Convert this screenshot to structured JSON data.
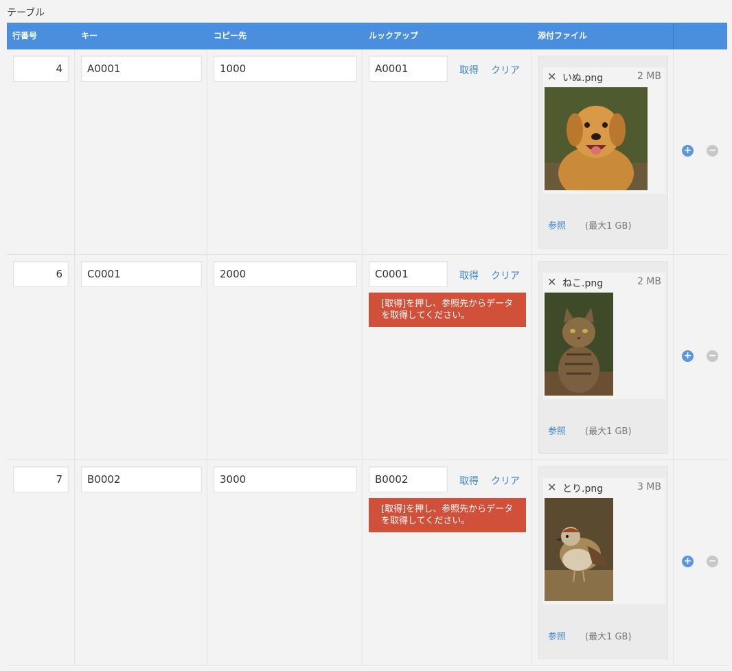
{
  "table_label": "テーブル",
  "headers": {
    "row_no": "行番号",
    "key": "キー",
    "copy_to": "コピー先",
    "lookup": "ルックアップ",
    "attachment": "添付ファイル"
  },
  "rows": [
    {
      "row_no": "4",
      "key": "A0001",
      "copy_to": "1000",
      "lookup": "A0001",
      "fetch": "取得",
      "clear": "クリア",
      "error": "",
      "file": {
        "name": "いぬ.png",
        "size": "2 MB",
        "icon": "dog-photo"
      },
      "browse": "参照",
      "limit": "(最大1 GB)"
    },
    {
      "row_no": "6",
      "key": "C0001",
      "copy_to": "2000",
      "lookup": "C0001",
      "fetch": "取得",
      "clear": "クリア",
      "error": "[取得]を押し、参照先からデータを取得してください。",
      "file": {
        "name": "ねこ.png",
        "size": "2 MB",
        "icon": "cat-photo"
      },
      "browse": "参照",
      "limit": "(最大1 GB)"
    },
    {
      "row_no": "7",
      "key": "B0002",
      "copy_to": "3000",
      "lookup": "B0002",
      "fetch": "取得",
      "clear": "クリア",
      "error": "[取得]を押し、参照先からデータを取得してください。",
      "file": {
        "name": "とり.png",
        "size": "3 MB",
        "icon": "bird-photo"
      },
      "browse": "参照",
      "limit": "(最大1 GB)"
    }
  ],
  "colors": {
    "header": "#4a8fdd",
    "link": "#3d83d0",
    "error": "#d1503a",
    "add": "#5b97dc",
    "remove": "#c7c7c7"
  }
}
